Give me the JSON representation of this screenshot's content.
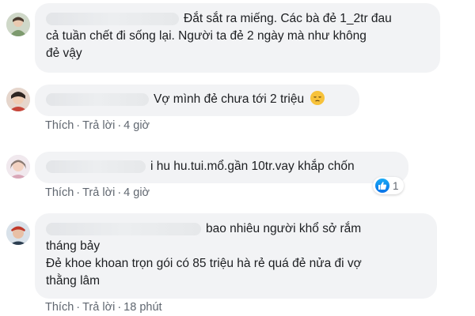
{
  "comments": [
    {
      "text_line1": "Đắt sắt ra miếng. Các bà đẻ 1_2tr đau",
      "text_line2": "cả tuần chết đi sống lại. Người ta đẻ 2 ngày mà như không",
      "text_line3": "đẻ vậy"
    },
    {
      "text": "Vợ mình đẻ chưa tới 2 triệu",
      "emoji": "pensive-face-emoji",
      "actions": {
        "like": "Thích",
        "reply": "Trả lời",
        "time": "4 giờ"
      }
    },
    {
      "text": "i hu hu.tui.mổ.gần 10tr.vay khắp chốn",
      "reaction_count": "1",
      "actions": {
        "like": "Thích",
        "reply": "Trả lời",
        "time": "4 giờ"
      }
    },
    {
      "text_line1": "bao nhiêu người khổ sở rắm",
      "text_line2": "tháng bảy",
      "text_line3": "Đẻ khoe khoan trọn gói có 85 triệu hà rẻ quá đẻ nửa đi vợ",
      "text_line4": "thằng lâm",
      "actions": {
        "like": "Thích",
        "reply": "Trả lời",
        "time": "18 phút"
      }
    }
  ],
  "separator": "·",
  "colors": {
    "bubble": "#f2f3f5",
    "meta": "#606770",
    "like_blue": "#1877f2"
  }
}
